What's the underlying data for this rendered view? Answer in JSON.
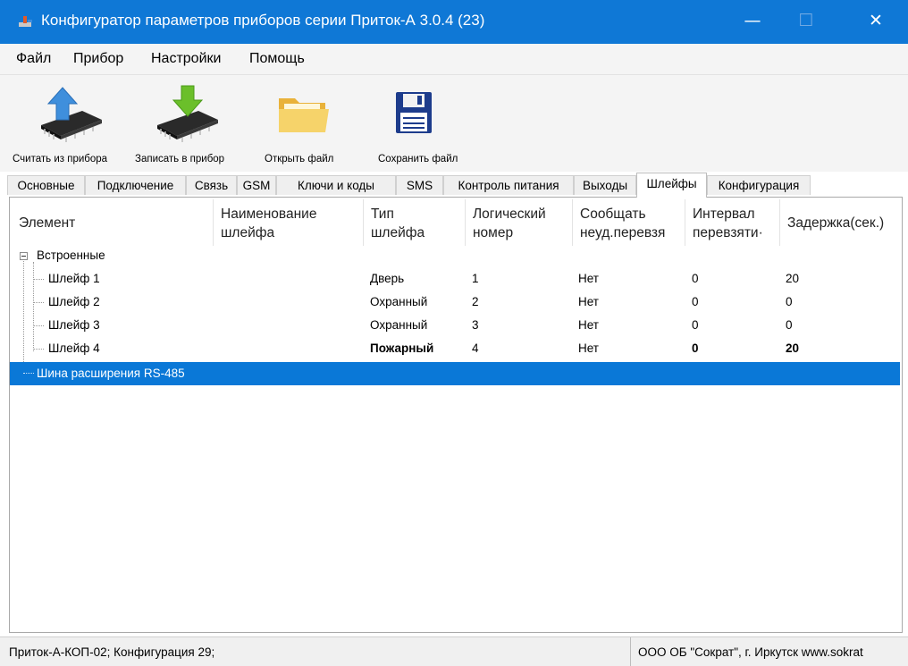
{
  "window": {
    "title": "Конфигуратор параметров приборов серии Приток-А  3.0.4 (23)",
    "min_glyph": "—",
    "max_glyph": "☐",
    "close_glyph": "✕",
    "accent": "#0f78d6"
  },
  "menu": [
    "Файл",
    "Прибор",
    "Настройки",
    "Помощь"
  ],
  "toolbar": {
    "read": "Считать из прибора",
    "write": "Записать в прибор",
    "open": "Открыть файл",
    "save": "Сохранить файл"
  },
  "tabs": [
    "Основные",
    "Подключение",
    "Связь",
    "GSM",
    "Ключи и коды",
    "SMS",
    "Контроль питания",
    "Выходы",
    "Шлейфы",
    "Конфигурация"
  ],
  "active_tab": "Шлейфы",
  "table": {
    "headers": [
      "Элемент",
      "Наименование\nшлейфа",
      "Тип\nшлейфа",
      "Логический\nномер",
      "Сообщать\nнеуд.перевзя",
      "Интервал\nперевзяти·",
      "Задержка(сек.)"
    ],
    "group": "Встроенные",
    "rows": [
      {
        "name": "Шлейф 1",
        "label": "",
        "type": "Дверь",
        "num": "1",
        "report": "Нет",
        "interval": "0",
        "delay": "20"
      },
      {
        "name": "Шлейф 2",
        "label": "",
        "type": "Охранный",
        "num": "2",
        "report": "Нет",
        "interval": "0",
        "delay": "0"
      },
      {
        "name": "Шлейф 3",
        "label": "",
        "type": "Охранный",
        "num": "3",
        "report": "Нет",
        "interval": "0",
        "delay": "0"
      },
      {
        "name": "Шлейф 4",
        "label": "",
        "type": "Пожарный",
        "num": "4",
        "report": "Нет",
        "interval": "0",
        "delay": "20"
      }
    ],
    "bus": "Шина расширения RS-485"
  },
  "status": {
    "left": "Приток-А-КОП-02; Конфигурация 29;",
    "right": "ООО ОБ \"Сократ\", г. Иркутск   www.sokrat"
  }
}
